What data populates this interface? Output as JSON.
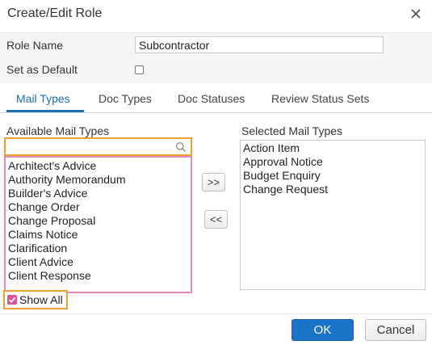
{
  "dialog": {
    "title": "Create/Edit Role",
    "close_icon": "close-icon"
  },
  "form": {
    "role_name_label": "Role Name",
    "role_name_value": "Subcontractor",
    "default_label": "Set as Default",
    "default_checked": false
  },
  "tabs": [
    {
      "label": "Mail Types",
      "active": true
    },
    {
      "label": "Doc Types",
      "active": false
    },
    {
      "label": "Doc Statuses",
      "active": false
    },
    {
      "label": "Review Status Sets",
      "active": false
    }
  ],
  "available": {
    "label": "Available Mail Types",
    "search_value": "",
    "search_icon": "search-icon",
    "items": [
      "Architect's Advice",
      "Authority Memorandum",
      "Builder's Advice",
      "Change Order",
      "Change Proposal",
      "Claims Notice",
      "Clarification",
      "Client Advice",
      "Client Response"
    ]
  },
  "selected": {
    "label": "Selected Mail Types",
    "items": [
      "Action Item",
      "Approval Notice",
      "Budget Enquiry",
      "Change Request"
    ]
  },
  "move_buttons": {
    "add_label": ">>",
    "remove_label": "<<"
  },
  "show_all": {
    "label": "Show All",
    "checked": true
  },
  "footer": {
    "ok_label": "OK",
    "cancel_label": "Cancel"
  },
  "colors": {
    "accent": "#1a75c8",
    "highlight_orange": "#f0a030",
    "highlight_pink": "#e38ab8",
    "checkbox_pink": "#d9539a"
  }
}
